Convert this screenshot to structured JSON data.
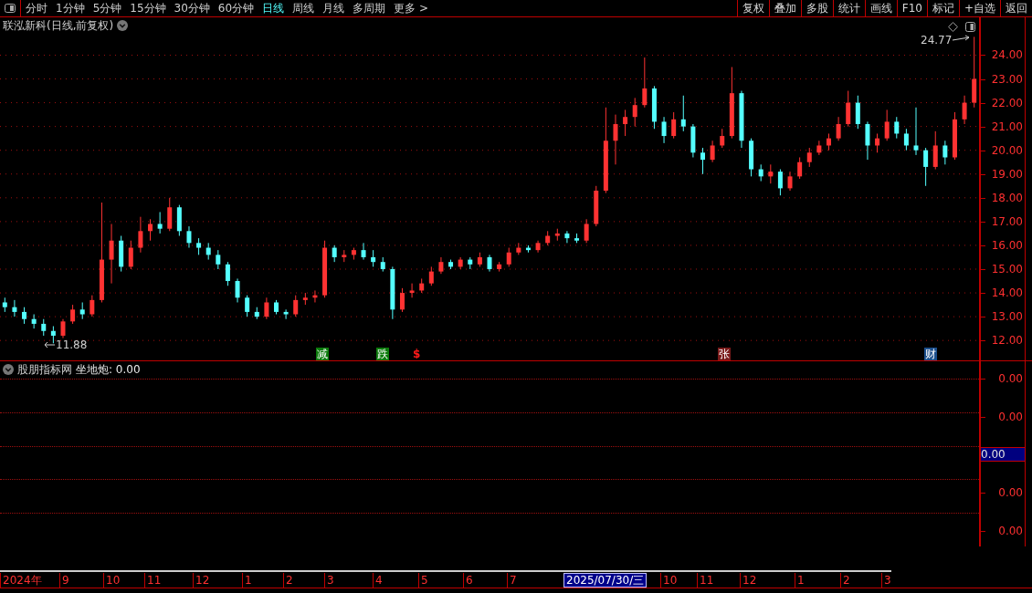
{
  "toolbar": {
    "periods": [
      {
        "label": "分时",
        "selected": false
      },
      {
        "label": "1分钟",
        "selected": false
      },
      {
        "label": "5分钟",
        "selected": false
      },
      {
        "label": "15分钟",
        "selected": false
      },
      {
        "label": "30分钟",
        "selected": false
      },
      {
        "label": "60分钟",
        "selected": false
      },
      {
        "label": "日线",
        "selected": true
      },
      {
        "label": "周线",
        "selected": false
      },
      {
        "label": "月线",
        "selected": false
      },
      {
        "label": "多周期",
        "selected": false
      },
      {
        "label": "更多 >",
        "selected": false
      }
    ],
    "buttons": [
      "复权",
      "叠加",
      "多股",
      "统计",
      "画线",
      "F10",
      "标记",
      "+自选",
      "返回"
    ]
  },
  "main_chart": {
    "title": "联泓新科(日线,前复权)",
    "high_label": "24.77",
    "low_label": "11.88",
    "chart_data": {
      "type": "candlestick",
      "ylim": [
        11.7,
        24.9
      ],
      "grid": true,
      "yticks": [
        {
          "value": 24,
          "label": "24.00"
        },
        {
          "value": 23,
          "label": "23.00"
        },
        {
          "value": 22,
          "label": "22.00"
        },
        {
          "value": 21,
          "label": "21.00"
        },
        {
          "value": 20,
          "label": "20.00"
        },
        {
          "value": 19,
          "label": "19.00"
        },
        {
          "value": 18,
          "label": "18.00"
        },
        {
          "value": 17,
          "label": "17.00"
        },
        {
          "value": 16,
          "label": "16.00"
        },
        {
          "value": 15,
          "label": "15.00"
        },
        {
          "value": 14,
          "label": "14.00"
        },
        {
          "value": 13,
          "label": "13.00"
        },
        {
          "value": 12,
          "label": "12.00"
        }
      ],
      "ohlc": [
        [
          13.6,
          13.8,
          13.2,
          13.4
        ],
        [
          13.4,
          13.7,
          13.0,
          13.2
        ],
        [
          13.2,
          13.4,
          12.7,
          12.9
        ],
        [
          12.9,
          13.1,
          12.5,
          12.7
        ],
        [
          12.7,
          12.9,
          12.2,
          12.4
        ],
        [
          12.4,
          12.6,
          11.88,
          12.2
        ],
        [
          12.2,
          12.9,
          12.1,
          12.8
        ],
        [
          12.8,
          13.5,
          12.7,
          13.3
        ],
        [
          13.3,
          13.6,
          12.9,
          13.1
        ],
        [
          13.1,
          13.9,
          13.0,
          13.7
        ],
        [
          13.7,
          17.8,
          13.6,
          15.4
        ],
        [
          15.4,
          16.9,
          14.4,
          16.2
        ],
        [
          16.2,
          16.4,
          14.9,
          15.1
        ],
        [
          15.1,
          16.2,
          15.0,
          15.9
        ],
        [
          15.9,
          17.2,
          15.7,
          16.6
        ],
        [
          16.6,
          17.1,
          16.2,
          16.9
        ],
        [
          16.9,
          17.4,
          16.5,
          16.7
        ],
        [
          16.7,
          18.0,
          16.6,
          17.6
        ],
        [
          17.6,
          17.7,
          16.4,
          16.6
        ],
        [
          16.6,
          16.8,
          15.9,
          16.1
        ],
        [
          16.1,
          16.3,
          15.6,
          15.9
        ],
        [
          15.9,
          16.1,
          15.4,
          15.6
        ],
        [
          15.6,
          15.8,
          15.0,
          15.2
        ],
        [
          15.2,
          15.3,
          14.3,
          14.5
        ],
        [
          14.5,
          14.6,
          13.6,
          13.8
        ],
        [
          13.8,
          13.9,
          13.0,
          13.2
        ],
        [
          13.2,
          13.4,
          12.9,
          13.0
        ],
        [
          13.0,
          13.8,
          12.9,
          13.6
        ],
        [
          13.6,
          13.7,
          13.1,
          13.2
        ],
        [
          13.2,
          13.3,
          12.9,
          13.1
        ],
        [
          13.1,
          13.9,
          13.0,
          13.7
        ],
        [
          13.7,
          14.0,
          13.5,
          13.8
        ],
        [
          13.8,
          14.1,
          13.6,
          13.9
        ],
        [
          13.9,
          16.2,
          13.8,
          15.9
        ],
        [
          15.9,
          16.0,
          15.3,
          15.5
        ],
        [
          15.5,
          15.8,
          15.3,
          15.6
        ],
        [
          15.6,
          15.9,
          15.4,
          15.8
        ],
        [
          15.8,
          16.1,
          15.4,
          15.5
        ],
        [
          15.5,
          15.8,
          15.1,
          15.3
        ],
        [
          15.3,
          15.5,
          14.9,
          15.0
        ],
        [
          15.0,
          15.1,
          12.9,
          13.3
        ],
        [
          13.3,
          14.2,
          13.2,
          14.0
        ],
        [
          14.0,
          14.4,
          13.8,
          14.1
        ],
        [
          14.1,
          14.6,
          14.0,
          14.4
        ],
        [
          14.4,
          15.1,
          14.3,
          14.9
        ],
        [
          14.9,
          15.5,
          14.8,
          15.3
        ],
        [
          15.3,
          15.4,
          15.0,
          15.1
        ],
        [
          15.1,
          15.5,
          15.0,
          15.4
        ],
        [
          15.4,
          15.5,
          15.0,
          15.2
        ],
        [
          15.2,
          15.7,
          15.1,
          15.5
        ],
        [
          15.5,
          15.6,
          14.9,
          15.0
        ],
        [
          15.0,
          15.3,
          14.9,
          15.2
        ],
        [
          15.2,
          15.9,
          15.1,
          15.7
        ],
        [
          15.7,
          16.1,
          15.6,
          15.9
        ],
        [
          15.9,
          16.0,
          15.7,
          15.8
        ],
        [
          15.8,
          16.2,
          15.7,
          16.1
        ],
        [
          16.1,
          16.6,
          16.0,
          16.4
        ],
        [
          16.4,
          16.7,
          16.2,
          16.5
        ],
        [
          16.5,
          16.6,
          16.1,
          16.3
        ],
        [
          16.3,
          16.5,
          16.1,
          16.2
        ],
        [
          16.2,
          17.1,
          16.1,
          16.9
        ],
        [
          16.9,
          18.5,
          16.8,
          18.3
        ],
        [
          18.3,
          21.8,
          18.2,
          20.4
        ],
        [
          20.4,
          21.5,
          19.4,
          21.1
        ],
        [
          21.1,
          21.7,
          20.6,
          21.4
        ],
        [
          21.4,
          22.2,
          21.0,
          21.9
        ],
        [
          21.9,
          23.9,
          21.8,
          22.6
        ],
        [
          22.6,
          22.7,
          20.9,
          21.2
        ],
        [
          21.2,
          21.4,
          20.3,
          20.6
        ],
        [
          20.6,
          21.6,
          20.5,
          21.3
        ],
        [
          21.3,
          22.3,
          20.8,
          21.0
        ],
        [
          21.0,
          21.1,
          19.7,
          19.9
        ],
        [
          19.9,
          20.1,
          19.0,
          19.6
        ],
        [
          19.6,
          20.4,
          19.5,
          20.2
        ],
        [
          20.2,
          20.9,
          20.1,
          20.6
        ],
        [
          20.6,
          23.5,
          20.5,
          22.4
        ],
        [
          22.4,
          22.5,
          20.1,
          20.4
        ],
        [
          20.4,
          20.5,
          18.9,
          19.2
        ],
        [
          19.2,
          19.4,
          18.7,
          18.9
        ],
        [
          18.9,
          19.4,
          18.6,
          19.1
        ],
        [
          19.1,
          19.2,
          18.1,
          18.4
        ],
        [
          18.4,
          19.1,
          18.3,
          18.9
        ],
        [
          18.9,
          19.7,
          18.8,
          19.5
        ],
        [
          19.5,
          20.1,
          19.3,
          19.9
        ],
        [
          19.9,
          20.4,
          19.8,
          20.2
        ],
        [
          20.2,
          20.7,
          20.0,
          20.5
        ],
        [
          20.5,
          21.4,
          20.4,
          21.1
        ],
        [
          21.1,
          22.5,
          21.0,
          22.0
        ],
        [
          22.0,
          22.3,
          20.9,
          21.1
        ],
        [
          21.1,
          21.2,
          19.6,
          20.2
        ],
        [
          20.2,
          20.7,
          19.9,
          20.5
        ],
        [
          20.5,
          21.7,
          20.4,
          21.2
        ],
        [
          21.2,
          21.4,
          20.5,
          20.7
        ],
        [
          20.7,
          20.9,
          20.0,
          20.2
        ],
        [
          20.2,
          21.8,
          19.8,
          20.0
        ],
        [
          20.0,
          20.1,
          18.5,
          19.3
        ],
        [
          19.3,
          20.8,
          19.2,
          20.2
        ],
        [
          20.2,
          20.4,
          19.4,
          19.7
        ],
        [
          19.7,
          21.6,
          19.6,
          21.3
        ],
        [
          21.3,
          22.3,
          21.1,
          22.0
        ],
        [
          22.0,
          24.77,
          21.8,
          23.0
        ]
      ]
    },
    "markers": [
      {
        "text": "减",
        "kind": "badge",
        "color": "#0b7a0b"
      },
      {
        "text": "跌",
        "kind": "badge",
        "color": "#0b7a0b"
      },
      {
        "text": "$",
        "kind": "plain",
        "color": "#ff1a1a"
      },
      {
        "text": "张",
        "kind": "badge",
        "color": "#7a1a1a"
      },
      {
        "text": "财",
        "kind": "badge",
        "color": "#1c4f8c"
      }
    ]
  },
  "indicator": {
    "name": "股朋指标网",
    "reading": "坐地炮: 0.00",
    "y_axis": [
      "0.00",
      "0.00",
      "0.00",
      "0.00"
    ],
    "cursor_value": "0.00"
  },
  "time_axis": [
    {
      "label": "2024年",
      "selected": false
    },
    {
      "label": "9",
      "selected": false
    },
    {
      "label": "10",
      "selected": false
    },
    {
      "label": "11",
      "selected": false
    },
    {
      "label": "12",
      "selected": false
    },
    {
      "label": "1",
      "selected": false
    },
    {
      "label": "2",
      "selected": false
    },
    {
      "label": "3",
      "selected": false
    },
    {
      "label": "4",
      "selected": false
    },
    {
      "label": "5",
      "selected": false
    },
    {
      "label": "6",
      "selected": false
    },
    {
      "label": "7",
      "selected": false
    },
    {
      "label": "2025/07/30/三",
      "selected": true
    },
    {
      "label": "10",
      "selected": false
    },
    {
      "label": "11",
      "selected": false
    },
    {
      "label": "12",
      "selected": false
    },
    {
      "label": "1",
      "selected": false
    },
    {
      "label": "2",
      "selected": false
    },
    {
      "label": "3",
      "selected": false
    }
  ]
}
